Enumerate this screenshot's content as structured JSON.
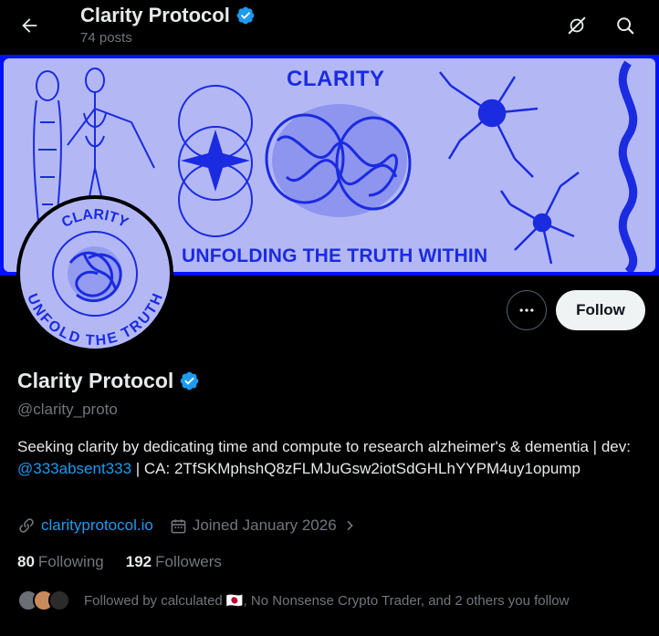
{
  "header": {
    "title": "Clarity Protocol",
    "posts": "74 posts",
    "icons": {
      "back": "arrow-left-icon",
      "verified": "verified-badge-icon",
      "grok": "grok-icon",
      "search": "search-icon"
    }
  },
  "banner": {
    "word": "CLARITY",
    "tagline": "UNFOLDING THE TRUTH WITHIN",
    "colors": {
      "frame": "#0011ff",
      "background": "#b3b8f5",
      "ink": "#1b2be0"
    }
  },
  "avatar": {
    "top_text": "CLARITY",
    "bottom_text": "UNFOLD THE TRUTH"
  },
  "actions": {
    "more_icon": "more-horizontal-icon",
    "follow_label": "Follow"
  },
  "profile": {
    "name": "Clarity Protocol",
    "handle": "@clarity_proto",
    "bio_part1": "Seeking clarity by dedicating time and compute to research alzheimer's & dementia | dev: ",
    "bio_mention": "@333absent333",
    "bio_part2": " | CA: 2TfSKMphshQ8zFLMJuGsw2iotSdGHLhYYPM4uy1opump",
    "website": "clarityprotocol.io",
    "joined": "Joined January 2026",
    "following_count": "80",
    "following_label": "Following",
    "followers_count": "192",
    "followers_label": "Followers",
    "followed_by": "Followed by calculated 🇯🇵, No Nonsense Crypto Trader, and 2 others you follow"
  },
  "colors": {
    "accent": "#1d9bf0",
    "muted": "#71767b",
    "text": "#e7e9ea",
    "verified": "#1d9bf0"
  }
}
